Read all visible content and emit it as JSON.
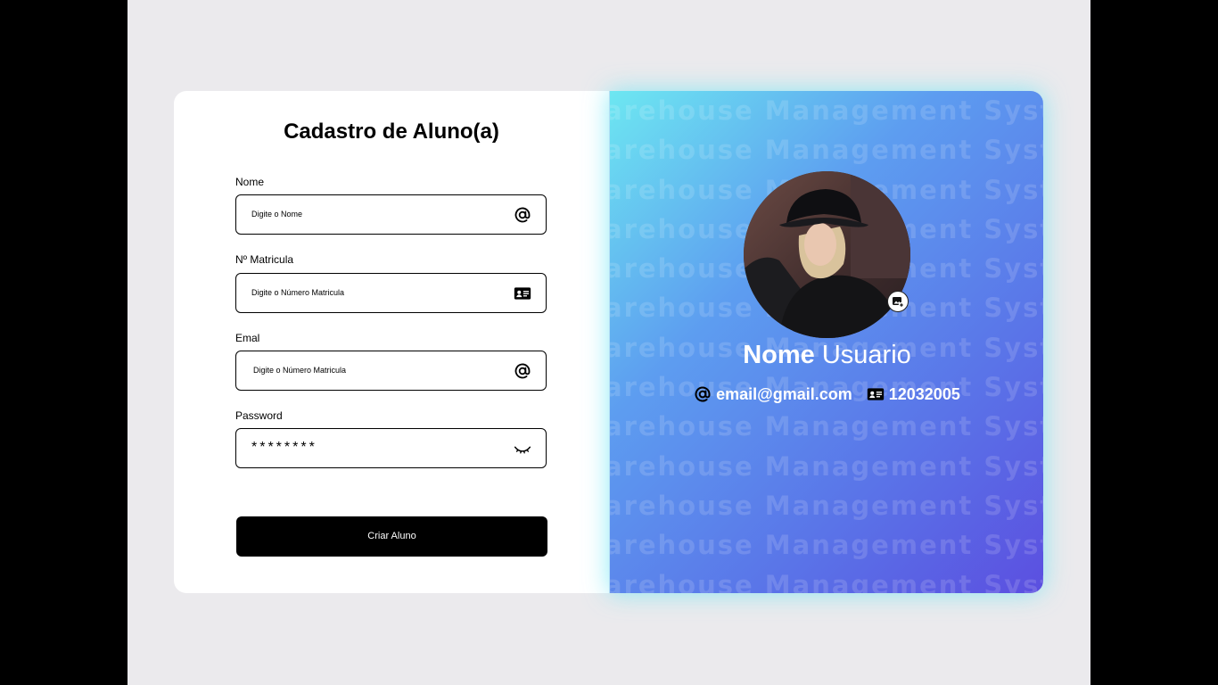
{
  "form": {
    "title": "Cadastro de Aluno(a)",
    "fields": [
      {
        "label": "Nome",
        "placeholder": "Digite o Nome",
        "icon": "at-icon"
      },
      {
        "label": "Nº Matricula",
        "placeholder": "Digite o Número Matricula",
        "icon": "id-card-icon"
      },
      {
        "label": "Emal",
        "placeholder": "Digite o Número Matricula",
        "icon": "at-icon"
      },
      {
        "label": "Password",
        "value": "********",
        "icon": "eye-closed-icon"
      }
    ],
    "submit_label": "Criar Aluno"
  },
  "profile": {
    "watermark_text": "arehouse Management Syster",
    "name_first": "Nome",
    "name_last": "Usuario",
    "email": "email@gmail.com",
    "matricula": "12032005",
    "avatar_icon": "add-photo-icon"
  },
  "colors": {
    "gradient_start": "#6de7f1",
    "gradient_end": "#5b4fe0",
    "button": "#000000",
    "background": "#ebeaed"
  }
}
